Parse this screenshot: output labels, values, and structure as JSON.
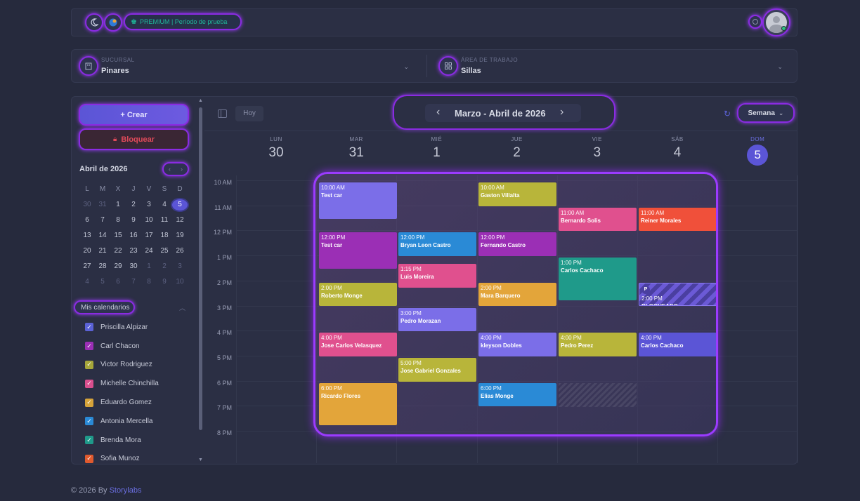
{
  "header": {
    "premium_label": "PREMIUM | Período de prueba"
  },
  "filters": {
    "branch_label": "SUCURSAL",
    "branch_value": "Pinares",
    "area_label": "ÁREA DE TRABAJO",
    "area_value": "Sillas"
  },
  "sidebar": {
    "create_label": "+ Crear",
    "block_label": "Bloquear",
    "month_title": "Abril de 2026",
    "weekday_headers": [
      "L",
      "M",
      "X",
      "J",
      "V",
      "S",
      "D"
    ],
    "weeks": [
      [
        "30",
        "31",
        "1",
        "2",
        "3",
        "4",
        "5"
      ],
      [
        "6",
        "7",
        "8",
        "9",
        "10",
        "11",
        "12"
      ],
      [
        "13",
        "14",
        "15",
        "16",
        "17",
        "18",
        "19"
      ],
      [
        "20",
        "21",
        "22",
        "23",
        "24",
        "25",
        "26"
      ],
      [
        "27",
        "28",
        "29",
        "30",
        "1",
        "2",
        "3"
      ],
      [
        "4",
        "5",
        "6",
        "7",
        "8",
        "9",
        "10"
      ]
    ],
    "calendars_title": "Mis calendarios",
    "calendars": [
      {
        "name": "Priscilla Alpizar",
        "color": "#5b62d6"
      },
      {
        "name": "Carl Chacon",
        "color": "#9b2fb5"
      },
      {
        "name": "Victor Rodriguez",
        "color": "#a6a63a"
      },
      {
        "name": "Michelle Chinchilla",
        "color": "#d94f8e"
      },
      {
        "name": "Eduardo Gomez",
        "color": "#d6a33a"
      },
      {
        "name": "Antonia Mercella",
        "color": "#2a8ad6"
      },
      {
        "name": "Brenda Mora",
        "color": "#1f9a8a"
      },
      {
        "name": "Sofia Munoz",
        "color": "#e05a2e"
      }
    ]
  },
  "toolbar": {
    "today_label": "Hoy",
    "range_title": "Marzo - Abril de 2026",
    "view_label": "Semana"
  },
  "week": {
    "days": [
      {
        "name": "LUN",
        "num": "30"
      },
      {
        "name": "MAR",
        "num": "31"
      },
      {
        "name": "MIÉ",
        "num": "1"
      },
      {
        "name": "JUE",
        "num": "2"
      },
      {
        "name": "VIE",
        "num": "3"
      },
      {
        "name": "SÁB",
        "num": "4"
      },
      {
        "name": "DOM",
        "num": "5"
      }
    ],
    "hours": [
      "10 AM",
      "11 AM",
      "12 PM",
      "1 PM",
      "2 PM",
      "3 PM",
      "4 PM",
      "5 PM",
      "6 PM",
      "7 PM",
      "8 PM"
    ]
  },
  "events": [
    {
      "time": "10:00 AM",
      "title": "Test car"
    },
    {
      "time": "12:00 PM",
      "title": "Test car"
    },
    {
      "time": "2:00 PM",
      "title": "Roberto Monge"
    },
    {
      "time": "4:00 PM",
      "title": "Jose Carlos Velasquez"
    },
    {
      "time": "6:00 PM",
      "title": "Ricardo Flores"
    },
    {
      "time": "12:00 PM",
      "title": "Bryan Leon Castro"
    },
    {
      "time": "1:15 PM",
      "title": "Luis Moreira"
    },
    {
      "time": "3:00 PM",
      "title": "Pedro Morazan"
    },
    {
      "time": "5:00 PM",
      "title": "Jose Gabriel Gonzales"
    },
    {
      "time": "10:00 AM",
      "title": "Gaston Villalta"
    },
    {
      "time": "12:00 PM",
      "title": "Fernando Castro"
    },
    {
      "time": "2:00 PM",
      "title": "Mara Barquero"
    },
    {
      "time": "4:00 PM",
      "title": "kleyson Dobles"
    },
    {
      "time": "6:00 PM",
      "title": "Elias Monge"
    },
    {
      "time": "11:00 AM",
      "title": "Bernardo Solis"
    },
    {
      "time": "1:00 PM",
      "title": "Carlos Cachaco"
    },
    {
      "time": "4:00 PM",
      "title": "Pedro Perez"
    },
    {
      "time": "11:00 AM",
      "title": "Reiner Morales"
    },
    {
      "time": "2:00 PM",
      "title": "BLOQUEADO",
      "badge": "P"
    },
    {
      "time": "4:00 PM",
      "title": "Carlos Cachaco"
    }
  ],
  "footer": {
    "copyright": "© 2026 By",
    "brand": "Storylabs"
  }
}
